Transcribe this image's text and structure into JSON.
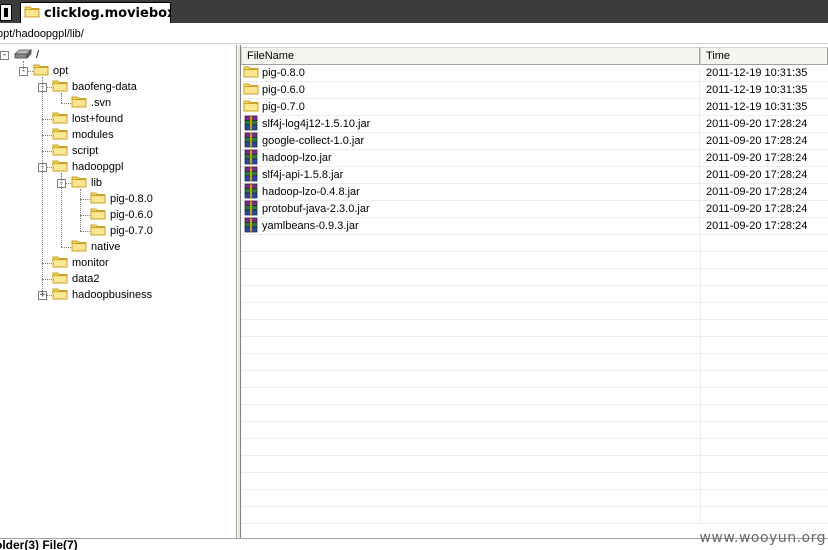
{
  "tab": {
    "title": "clicklog.moviebox..."
  },
  "path": {
    "value": "opt/hadoopgpl/lib/"
  },
  "tree": {
    "nodes": [
      {
        "label": "/",
        "icon": "drive-icon",
        "depth": 0,
        "toggle": "-"
      },
      {
        "label": "opt",
        "icon": "folder-icon",
        "depth": 1,
        "toggle": "-"
      },
      {
        "label": "baofeng-data",
        "icon": "folder-icon",
        "depth": 2,
        "toggle": "-"
      },
      {
        "label": ".svn",
        "icon": "folder-icon",
        "depth": 3,
        "toggle": ""
      },
      {
        "label": "lost+found",
        "icon": "folder-icon",
        "depth": 2,
        "toggle": ""
      },
      {
        "label": "modules",
        "icon": "folder-icon",
        "depth": 2,
        "toggle": ""
      },
      {
        "label": "script",
        "icon": "folder-icon",
        "depth": 2,
        "toggle": ""
      },
      {
        "label": "hadoopgpl",
        "icon": "folder-icon",
        "depth": 2,
        "toggle": "-"
      },
      {
        "label": "lib",
        "icon": "folder-icon",
        "depth": 3,
        "toggle": "-"
      },
      {
        "label": "pig-0.8.0",
        "icon": "folder-icon",
        "depth": 4,
        "toggle": ""
      },
      {
        "label": "pig-0.6.0",
        "icon": "folder-icon",
        "depth": 4,
        "toggle": ""
      },
      {
        "label": "pig-0.7.0",
        "icon": "folder-icon",
        "depth": 4,
        "toggle": ""
      },
      {
        "label": "native",
        "icon": "folder-icon",
        "depth": 3,
        "toggle": ""
      },
      {
        "label": "monitor",
        "icon": "folder-icon",
        "depth": 2,
        "toggle": ""
      },
      {
        "label": "data2",
        "icon": "folder-icon",
        "depth": 2,
        "toggle": ""
      },
      {
        "label": "hadoopbusiness",
        "icon": "folder-icon",
        "depth": 2,
        "toggle": "+"
      }
    ]
  },
  "list": {
    "columns": {
      "name": "FileName",
      "time": "Time"
    },
    "rows": [
      {
        "name": "pig-0.8.0",
        "time": "2011-12-19 10:31:35",
        "icon": "folder-icon"
      },
      {
        "name": "pig-0.6.0",
        "time": "2011-12-19 10:31:35",
        "icon": "folder-icon"
      },
      {
        "name": "pig-0.7.0",
        "time": "2011-12-19 10:31:35",
        "icon": "folder-icon"
      },
      {
        "name": "slf4j-log4j12-1.5.10.jar",
        "time": "2011-09-20 17:28:24",
        "icon": "archive-icon"
      },
      {
        "name": "google-collect-1.0.jar",
        "time": "2011-09-20 17:28:24",
        "icon": "archive-icon"
      },
      {
        "name": "hadoop-lzo.jar",
        "time": "2011-09-20 17:28:24",
        "icon": "archive-icon"
      },
      {
        "name": "slf4j-api-1.5.8.jar",
        "time": "2011-09-20 17:28:24",
        "icon": "archive-icon"
      },
      {
        "name": "hadoop-lzo-0.4.8.jar",
        "time": "2011-09-20 17:28:24",
        "icon": "archive-icon"
      },
      {
        "name": "protobuf-java-2.3.0.jar",
        "time": "2011-09-20 17:28:24",
        "icon": "archive-icon"
      },
      {
        "name": "yamlbeans-0.9.3.jar",
        "time": "2011-09-20 17:28:24",
        "icon": "archive-icon"
      }
    ]
  },
  "status": {
    "text": "older(3) File(7)"
  },
  "watermark": {
    "text": "www.wooyun.org"
  },
  "colors": {
    "tabbar": "#3c3c3c",
    "folder": "#f5d76e",
    "folder_edge": "#c9a227"
  }
}
